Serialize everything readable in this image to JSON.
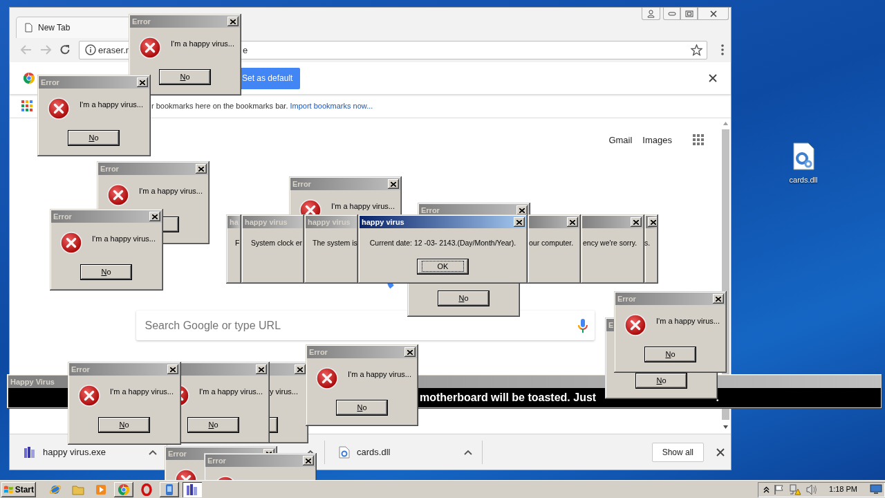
{
  "browser": {
    "tab_title": "New Tab",
    "url_start": "eraser.n",
    "url_end": "e",
    "infobar_button": "Set as default",
    "bookmarks_text": "r bookmarks here on the bookmarks bar.",
    "bookmarks_link": "Import bookmarks now...",
    "header_links": [
      "Gmail",
      "Images"
    ],
    "search": {
      "placeholder": "Search Google or type URL"
    },
    "downloads": [
      {
        "kind": "program",
        "name": "happy virus.exe"
      },
      {
        "kind": "covered"
      },
      {
        "kind": "library",
        "name": "cards.dll"
      }
    ],
    "show_all": "Show all"
  },
  "desktop_icons": [
    {
      "label": "cards.dll"
    }
  ],
  "dialogs": [
    {
      "kind": "error",
      "active": false,
      "title": "Error",
      "close": true,
      "icon": true,
      "text": "I'm a happy virus...",
      "button": true,
      "button_label": "No"
    },
    {
      "kind": "error",
      "active": false,
      "title": "Error",
      "close": true,
      "icon": true,
      "text": "I'm a happy virus...",
      "button": true,
      "button_label": "No"
    },
    {
      "kind": "error",
      "active": false,
      "title": "Error",
      "close": true,
      "icon": true,
      "text": "I'm a happy virus...",
      "button": true
    },
    {
      "kind": "error",
      "active": false,
      "title": "Error",
      "close": true,
      "icon": true,
      "text": "I'm a happy virus...",
      "button": true,
      "button_label": "No"
    },
    {
      "kind": "error",
      "active": false,
      "title": "Error",
      "close": true,
      "icon": true,
      "text": "I'm a happy virus...",
      "button": false
    },
    {
      "kind": "error",
      "active": false,
      "title": "Error",
      "close": true,
      "icon": false,
      "button": false
    },
    {
      "kind": "error",
      "active": false,
      "close": false,
      "icon": false,
      "button": true,
      "button_label": "No"
    },
    {
      "kind": "message",
      "active": false,
      "title": "ha",
      "close": false,
      "text": "F",
      "button": false
    },
    {
      "kind": "message",
      "active": false,
      "title": "happy virus",
      "close": false,
      "text": "System clock er",
      "button": false
    },
    {
      "kind": "message",
      "active": false,
      "title": "happy virus",
      "close": false,
      "text": "The system is",
      "button": false
    },
    {
      "kind": "message",
      "active": true,
      "title": "happy virus",
      "close": true,
      "text": "Current date: 12 -03- 2143.(Day/Month/Year).",
      "button": true,
      "button_label": "OK"
    },
    {
      "kind": "message",
      "active": false,
      "close": true,
      "text": "our computer.",
      "button": false
    },
    {
      "kind": "message",
      "active": false,
      "close": true,
      "text": "ency we're sorry.",
      "button": false
    },
    {
      "kind": "message",
      "active": false,
      "close": true,
      "text": "s.",
      "button": false
    }
  ],
  "banner": {
    "title": "Happy Virus",
    "text": "motherboard will be toasted. Just",
    "text_tail": "."
  },
  "dialogs_front": [
    {
      "kind": "error",
      "active": false,
      "title": "E",
      "close": false,
      "icon": false,
      "button": true,
      "button_label": "No"
    },
    {
      "kind": "error",
      "active": false,
      "title": "Error",
      "close": true,
      "icon": true,
      "text": "I'm a happy virus...",
      "button": true,
      "button_label": "No"
    },
    {
      "kind": "error",
      "active": false,
      "close": true,
      "icon": true,
      "text": "I'm a happy virus...",
      "button": true,
      "button_label": "No"
    },
    {
      "kind": "error",
      "active": false,
      "close": true,
      "icon": false,
      "text": "y virus...",
      "button": true
    },
    {
      "kind": "error",
      "active": false,
      "title": "Error",
      "close": true,
      "icon": true,
      "text": "I'm a happy virus...",
      "button": true,
      "button_label": "No"
    },
    {
      "kind": "error",
      "active": false,
      "title": "Error",
      "close": true,
      "icon": true,
      "text": "I'm a happy virus...",
      "button": true,
      "button_label": "No"
    },
    {
      "kind": "error",
      "active": false,
      "title": "Error",
      "close": true,
      "icon": true,
      "button": false
    },
    {
      "kind": "error",
      "active": false,
      "title": "Error",
      "close": true,
      "icon": true,
      "button": false
    }
  ],
  "taskbar": {
    "start": "Start",
    "items": [
      {
        "kind": "ie",
        "open": false,
        "selected": false
      },
      {
        "kind": "folder",
        "open": false,
        "selected": false
      },
      {
        "kind": "media",
        "open": false,
        "selected": false
      },
      {
        "kind": "chrome",
        "open": true,
        "selected": false
      },
      {
        "kind": "opera",
        "open": false,
        "selected": false
      },
      {
        "kind": "app",
        "open": true,
        "selected": false
      },
      {
        "kind": "virus",
        "open": true,
        "selected": true
      }
    ],
    "clock": "1:18 PM"
  }
}
